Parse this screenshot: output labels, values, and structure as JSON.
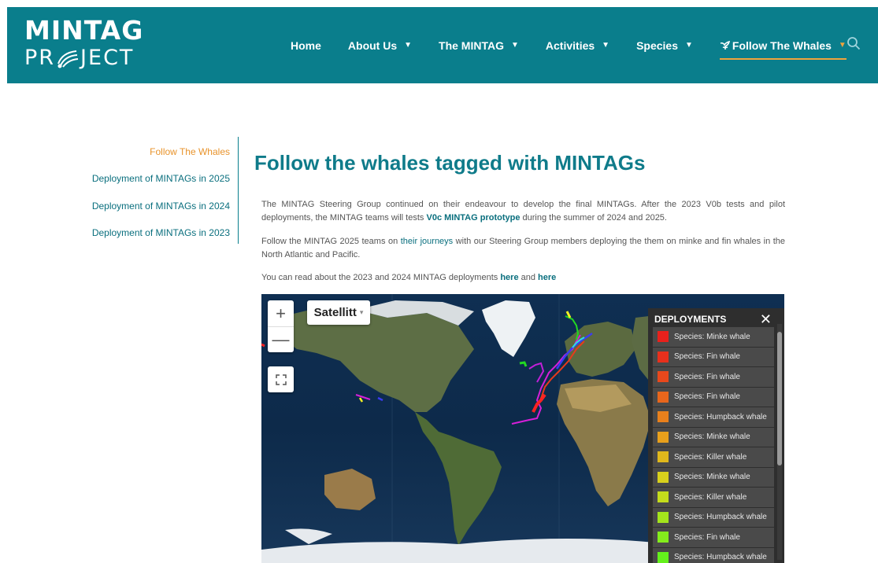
{
  "header": {
    "logo_top": "MINTAG",
    "logo_bottom_left": "PR",
    "logo_bottom_right": "JECT",
    "nav": [
      {
        "label": "Home",
        "has_caret": false
      },
      {
        "label": "About Us",
        "has_caret": true
      },
      {
        "label": "The MINTAG",
        "has_caret": true
      },
      {
        "label": "Activities",
        "has_caret": true
      },
      {
        "label": "Species",
        "has_caret": true
      },
      {
        "label": "Follow The Whales",
        "has_caret": true
      }
    ],
    "caret": "▼",
    "search_icon": "search-icon"
  },
  "sidebar": {
    "items": [
      "Follow The Whales",
      "Deployment of MINTAGs in 2025",
      "Deployment of MINTAGs in 2024",
      "Deployment of MINTAGs in 2023"
    ]
  },
  "main": {
    "title": "Follow the whales tagged with MINTAGs",
    "p1_a": "The MINTAG Steering Group continued on their endeavour to develop the final MINTAGs. After the 2023 V0b tests and pilot deployments, the MINTAG teams will tests ",
    "p1_link": "V0c MINTAG prototype",
    "p1_b": " during the summer of 2024 and 2025.",
    "p2_a": "Follow the MINTAG 2025 teams on ",
    "p2_link": "their journeys",
    "p2_b": " with our Steering Group members deploying the  them on minke and fin whales in the North Atlantic and Pacific.",
    "p3_a": "You can read about the 2023 and 2024 MINTAG deployments ",
    "p3_link1": "here",
    "p3_and": " and ",
    "p3_link2": "here"
  },
  "map": {
    "zoom_in": "+",
    "zoom_out": "—",
    "layer": "Satellitt",
    "layer_caret": "▾",
    "panel_title": "DEPLOYMENTS",
    "close": "✕",
    "deployments": [
      {
        "label": "Species: Minke whale",
        "color": "#e8211c"
      },
      {
        "label": "Species: Fin whale",
        "color": "#e8301c"
      },
      {
        "label": "Species: Fin whale",
        "color": "#e8481c"
      },
      {
        "label": "Species: Fin whale",
        "color": "#e8661c"
      },
      {
        "label": "Species: Humpback whale",
        "color": "#e8801c"
      },
      {
        "label": "Species: Minke whale",
        "color": "#e8a01c"
      },
      {
        "label": "Species: Killer whale",
        "color": "#e0b81c"
      },
      {
        "label": "Species: Minke whale",
        "color": "#d8d01c"
      },
      {
        "label": "Species: Killer whale",
        "color": "#c4dc1c"
      },
      {
        "label": "Species: Humpback whale",
        "color": "#a4e41c"
      },
      {
        "label": "Species: Fin whale",
        "color": "#84ec1c"
      },
      {
        "label": "Species: Humpback whale",
        "color": "#64f01c"
      }
    ]
  },
  "colors": {
    "header_bg": "#0a7e8c",
    "accent": "#f0a33c",
    "link": "#0a6f7e",
    "title": "#0f7b8a"
  }
}
